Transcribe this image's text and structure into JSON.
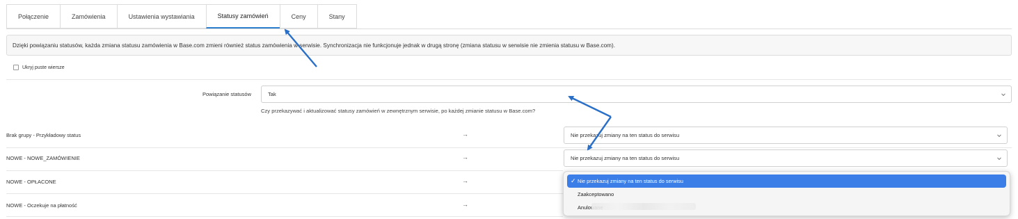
{
  "tabs": [
    {
      "label": "Połączenie"
    },
    {
      "label": "Zamówienia"
    },
    {
      "label": "Ustawienia wystawiania"
    },
    {
      "label": "Statusy zamówień"
    },
    {
      "label": "Ceny"
    },
    {
      "label": "Stany"
    }
  ],
  "active_tab": "Statusy zamówień",
  "info_text": "Dzięki powiązaniu statusów, każda zmiana statusu zamówienia w Base.com zmieni również status zamówienia w serwisie. Synchronizacja nie funkcjonuje jednak w drugą stronę (zmiana statusu w serwisie nie zmienia statusu w Base.com).",
  "hide_empty": {
    "label": "Ukryj puste wiersze",
    "checked": false
  },
  "status_binding": {
    "label": "Powiązanie statusów",
    "value": "Tak",
    "help": "Czy przekazywać i aktualizować statusy zamówień w zewnętrznym serwisie, po każdej zmianie statusu w Base.com?"
  },
  "arrow_glyph": "→",
  "rows": [
    {
      "label": "Brak grupy - Przykładowy status",
      "value": "Nie przekazuj zmiany na ten status do serwisu"
    },
    {
      "label": "NOWE - NOWE_ZAMÓWIENIE",
      "value": "Nie przekazuj zmiany na ten status do serwisu"
    },
    {
      "label": "NOWE - OPŁACONE"
    },
    {
      "label": "NOWE - Oczekuje na płatność"
    }
  ],
  "dropdown": {
    "options": [
      {
        "label": "Nie przekazuj zmiany na ten status do serwisu",
        "selected": true
      },
      {
        "label": "Zaakceptowano",
        "selected": false
      },
      {
        "label": "Anulowane",
        "selected": false
      }
    ],
    "check_glyph": "✓"
  },
  "colors": {
    "accent": "#2d7fd0",
    "annotation": "#2a6fc7",
    "menu_highlight": "#3b7ee8"
  },
  "icons": {
    "select_chevron": "chevron-down-icon",
    "row_arrow": "arrow-right-icon"
  }
}
